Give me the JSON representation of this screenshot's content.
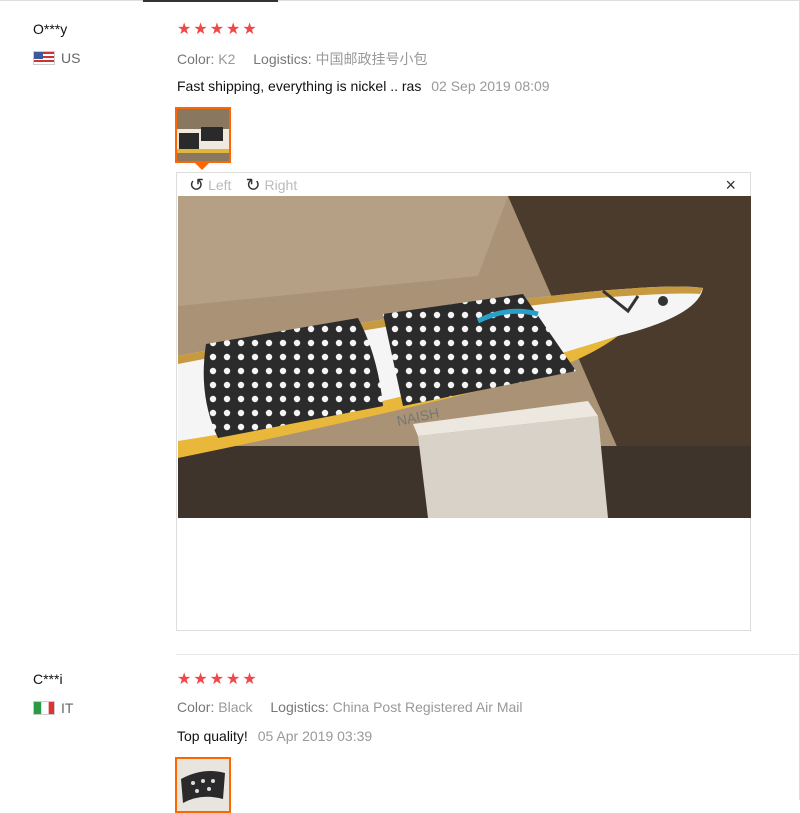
{
  "reviews": [
    {
      "user": "O***y",
      "country": "US",
      "stars": 5,
      "color_label": "Color:",
      "color_value": "K2",
      "logistics_label": "Logistics:",
      "logistics_value": "中国邮政挂号小包",
      "text": "Fast shipping, everything is nickel .. ras",
      "date": "02 Sep 2019 08:09"
    },
    {
      "user": "C***i",
      "country": "IT",
      "stars": 5,
      "color_label": "Color:",
      "color_value": "Black",
      "logistics_label": "Logistics:",
      "logistics_value": "China Post Registered Air Mail",
      "text": "Top quality!",
      "date": "05 Apr 2019 03:39"
    }
  ],
  "viewer": {
    "rotate_left": "Left",
    "rotate_right": "Right",
    "close": "×",
    "rotate_left_icon": "↺",
    "rotate_right_icon": "↻"
  },
  "star_glyph": "★",
  "colors": {
    "star": "#f04848",
    "accent": "#ff6600"
  }
}
